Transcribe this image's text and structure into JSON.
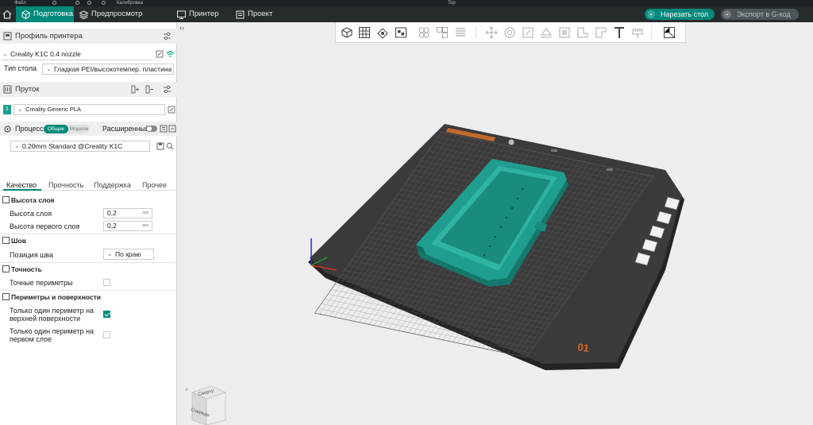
{
  "titlebar": {
    "menu_label": "Файл",
    "app_label": "Калибровка",
    "window_title": "Top"
  },
  "tabs": [
    {
      "label": "Подготовка",
      "icon": "cube-icon",
      "active": true
    },
    {
      "label": "Предпросмотр нарезки",
      "icon": "layers-icon",
      "active": false
    },
    {
      "label": "Принтер",
      "icon": "monitor-icon",
      "active": false
    },
    {
      "label": "Проект",
      "icon": "folder-icon",
      "active": false
    }
  ],
  "toolbar": {
    "slice_label": "Нарезать стол",
    "export_label": "Экспорт в G-код"
  },
  "printer": {
    "section_label": "Профиль принтера",
    "profile": "Creality K1C 0.4 nozzle",
    "bed_label": "Тип стола",
    "bed_value": "Гладкая PEI/высокотемпер. пластина"
  },
  "filament": {
    "section_label": "Пруток",
    "slot": "1",
    "profile": "Creality Generic PLA",
    "color": "#1f9e8f"
  },
  "process": {
    "label": "Процесс",
    "toggle_on": "Общие",
    "toggle_off": "Модели",
    "advanced_label": "Расширенный",
    "profile": "0.20mm Standard @Creality K1C"
  },
  "settings_tabs": [
    "Качество",
    "Прочность",
    "Поддержка",
    "Прочее"
  ],
  "quality": {
    "layer_group": "Высота слоя",
    "layer_height_label": "Высота слоя",
    "layer_height_value": "0,2",
    "first_layer_label": "Высота первого слоя",
    "first_layer_value": "0,2",
    "unit": "мм",
    "seam_group": "Шов",
    "seam_label": "Позиция шва",
    "seam_value": "По краю",
    "precision_group": "Точность",
    "precise_walls_label": "Точные периметры",
    "precise_walls_checked": false,
    "walls_group": "Периметры и поверхности",
    "top_one_wall_label_1": "Только один периметр на",
    "top_one_wall_label_2": "верхней поверхности",
    "top_one_wall_checked": true,
    "first_one_wall_label_1": "Только один периметр на",
    "first_one_wall_label_2": "первом слое",
    "first_one_wall_checked": false
  },
  "viewport": {
    "plate_number": "01",
    "cube_top": "Сверху",
    "cube_front": "Спереди",
    "accent": "#00897b",
    "model_color": "#1f9e8f"
  }
}
